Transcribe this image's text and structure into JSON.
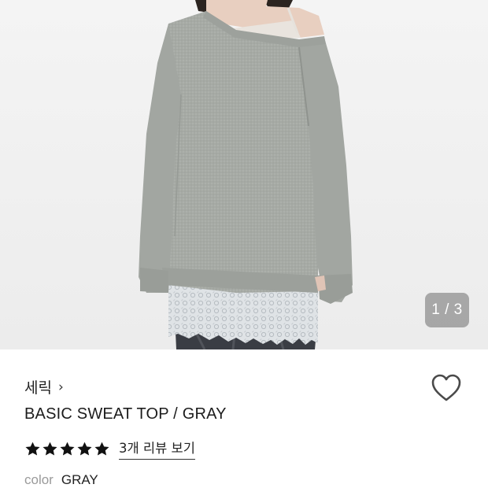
{
  "gallery": {
    "image_description_icon": "product-photo",
    "pager_text": "1 / 3",
    "current": 1,
    "total": 3
  },
  "product": {
    "brand": "세릭",
    "brand_chevron": "›",
    "title": "BASIC SWEAT TOP / GRAY",
    "rating": 5,
    "rating_max": 5,
    "review_link": "3개 리뷰 보기",
    "option_label": "color",
    "option_value": "GRAY"
  },
  "icons": {
    "wishlist": "heart-outline-icon",
    "star": "star-filled-icon",
    "chevron": "chevron-right-icon"
  },
  "colors": {
    "star": "#111111",
    "sweater": "#a7aba6",
    "pager_bg": "rgba(110,110,110,0.55)"
  }
}
